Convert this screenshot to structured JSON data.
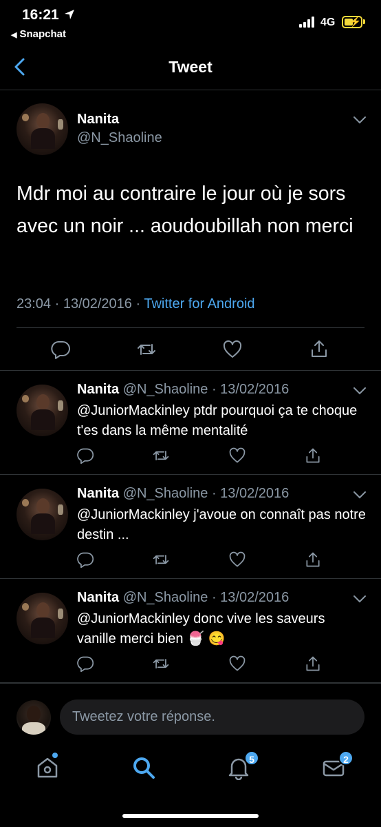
{
  "status_bar": {
    "time": "16:21",
    "back_app": "Snapchat",
    "network": "4G",
    "icons": [
      "location-arrow-icon",
      "signal-icon",
      "battery-charging-icon"
    ]
  },
  "header": {
    "title": "Tweet"
  },
  "main_tweet": {
    "name": "Nanita",
    "handle": "@N_Shaoline",
    "text": "Mdr moi au contraire le jour où je sors avec un noir ... aoudoubillah non merci",
    "time": "23:04 · 13/02/2016 · ",
    "source": "Twitter for Android"
  },
  "replies": [
    {
      "name": "Nanita",
      "handle": "@N_Shaoline",
      "date": "· 13/02/2016",
      "text": "@JuniorMackinley ptdr pourquoi ça te choque t'es dans la même mentalité"
    },
    {
      "name": "Nanita",
      "handle": "@N_Shaoline",
      "date": "· 13/02/2016",
      "text": "@JuniorMackinley j'avoue on connaît pas notre destin ..."
    },
    {
      "name": "Nanita",
      "handle": "@N_Shaoline",
      "date": "· 13/02/2016",
      "text": "@JuniorMackinley donc vive les saveurs vanille merci bien 🍧 😋"
    }
  ],
  "compose": {
    "placeholder": "Tweetez votre réponse."
  },
  "tab_bar": {
    "notifications_badge": "5",
    "messages_badge": "2"
  },
  "colors": {
    "accent": "#4da8f0",
    "background": "#000000",
    "secondary_text": "#8b98a5",
    "divider": "#2f3336"
  }
}
